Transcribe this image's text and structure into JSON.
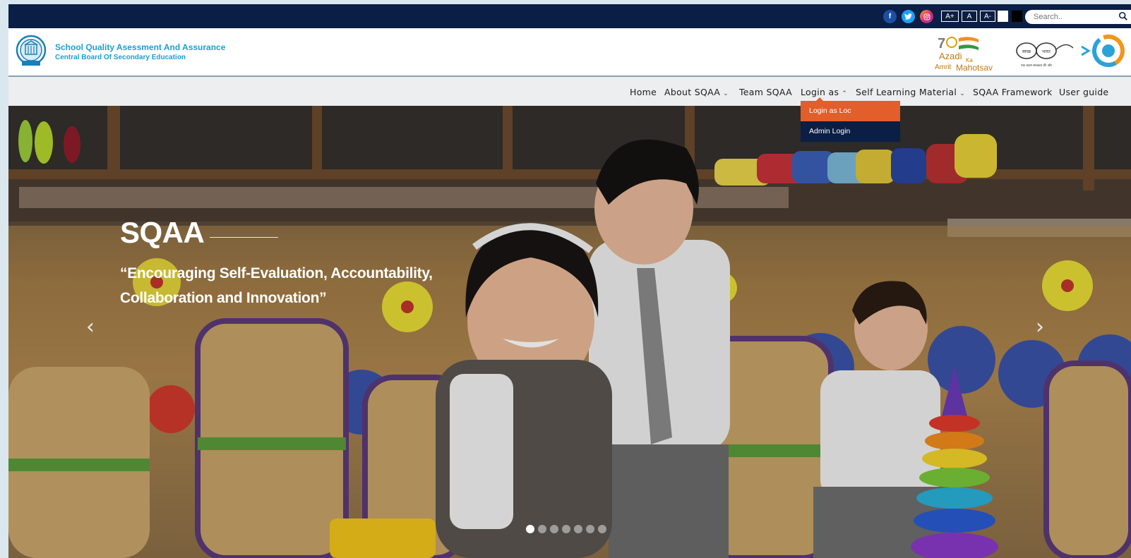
{
  "topbar": {
    "social": [
      {
        "name": "facebook",
        "glyph": "f"
      },
      {
        "name": "twitter",
        "glyph": "t"
      },
      {
        "name": "instagram",
        "glyph": "◎"
      }
    ],
    "font_controls": [
      "A+",
      "A",
      "A-"
    ],
    "theme_swatches": [
      "#ffffff",
      "#000000"
    ],
    "search": {
      "placeholder": "Search.."
    }
  },
  "header": {
    "title": "School Quality Asessment And Assurance",
    "subtitle": "Central Board Of Secondary Education",
    "azadi": {
      "line1": "Azadi",
      "ka": "Ka",
      "line2": "Amrit",
      "line3": "Mahotsav"
    },
    "swachh": {
      "left": "स्वच्छ",
      "right": "भारत",
      "caption": "एक कदम स्वच्छता की ओर"
    }
  },
  "nav": {
    "items": [
      {
        "label": "Home",
        "caret": ""
      },
      {
        "label": "About SQAA",
        "caret": "⌄"
      },
      {
        "label": "Team SQAA",
        "caret": ""
      },
      {
        "label": "Login as",
        "caret": "⌃"
      },
      {
        "label": "Self Learning Material",
        "caret": "⌄"
      },
      {
        "label": "SQAA Framework",
        "caret": ""
      },
      {
        "label": "User guide",
        "caret": ""
      }
    ],
    "dropdown": [
      {
        "label": "Login as Loc",
        "active": true
      },
      {
        "label": "Admin Login",
        "active": false
      }
    ]
  },
  "hero": {
    "title": "SQAA",
    "quote": "“Encouraging Self-Evaluation, Accountability, Collaboration and Innovation”",
    "prev_arrow": "‹",
    "next_arrow": "›",
    "slides_total": 7,
    "slide_active": 1
  },
  "colors": {
    "topbar": "#0b1e45",
    "brand_blue": "#1a9fd6",
    "dropdown_active": "#e25e2a",
    "nav_bg": "#eceef0"
  }
}
